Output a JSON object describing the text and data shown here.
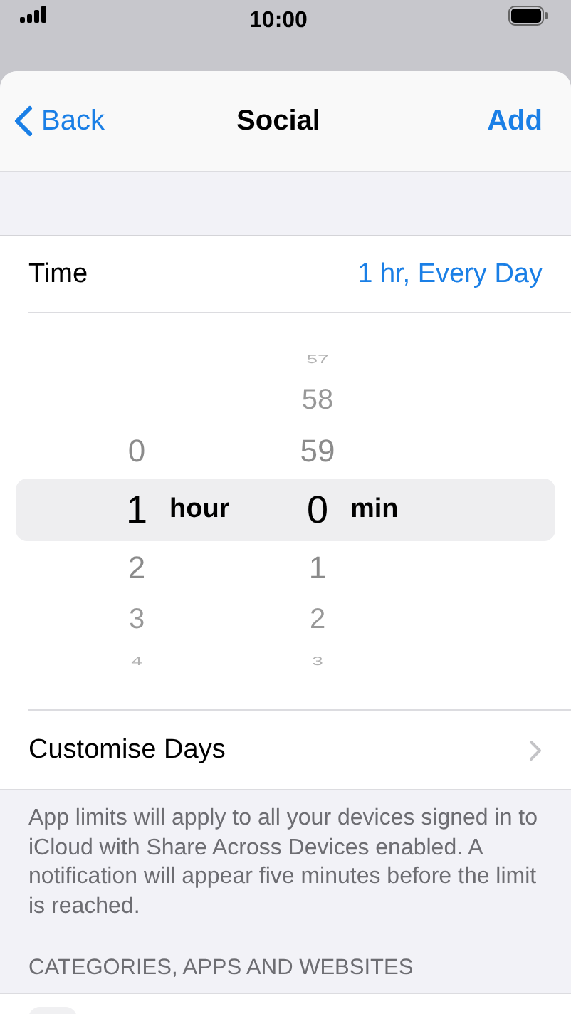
{
  "status_bar": {
    "time": "10:00"
  },
  "nav": {
    "back": "Back",
    "title": "Social",
    "action": "Add"
  },
  "time_row": {
    "label": "Time",
    "value": "1 hr, Every Day"
  },
  "picker": {
    "columns": [
      {
        "unit": "hour",
        "items": [
          {
            "value": "0",
            "selected": false
          },
          {
            "value": "1",
            "selected": true
          },
          {
            "value": "2",
            "selected": false
          },
          {
            "value": "3",
            "selected": false
          },
          {
            "value": "4",
            "selected": false
          }
        ]
      },
      {
        "unit": "min",
        "items": [
          {
            "value": "57",
            "selected": false
          },
          {
            "value": "58",
            "selected": false
          },
          {
            "value": "59",
            "selected": false
          },
          {
            "value": "0",
            "selected": true
          },
          {
            "value": "1",
            "selected": false
          },
          {
            "value": "2",
            "selected": false
          },
          {
            "value": "3",
            "selected": false
          }
        ]
      }
    ]
  },
  "days_row": {
    "label": "Customise Days"
  },
  "footer": "App limits will apply to all your devices signed in to iCloud with Share Across Devices enabled. A notification will appear five minutes before the limit is reached.",
  "section_header": "CATEGORIES, APPS AND WEBSITES"
}
